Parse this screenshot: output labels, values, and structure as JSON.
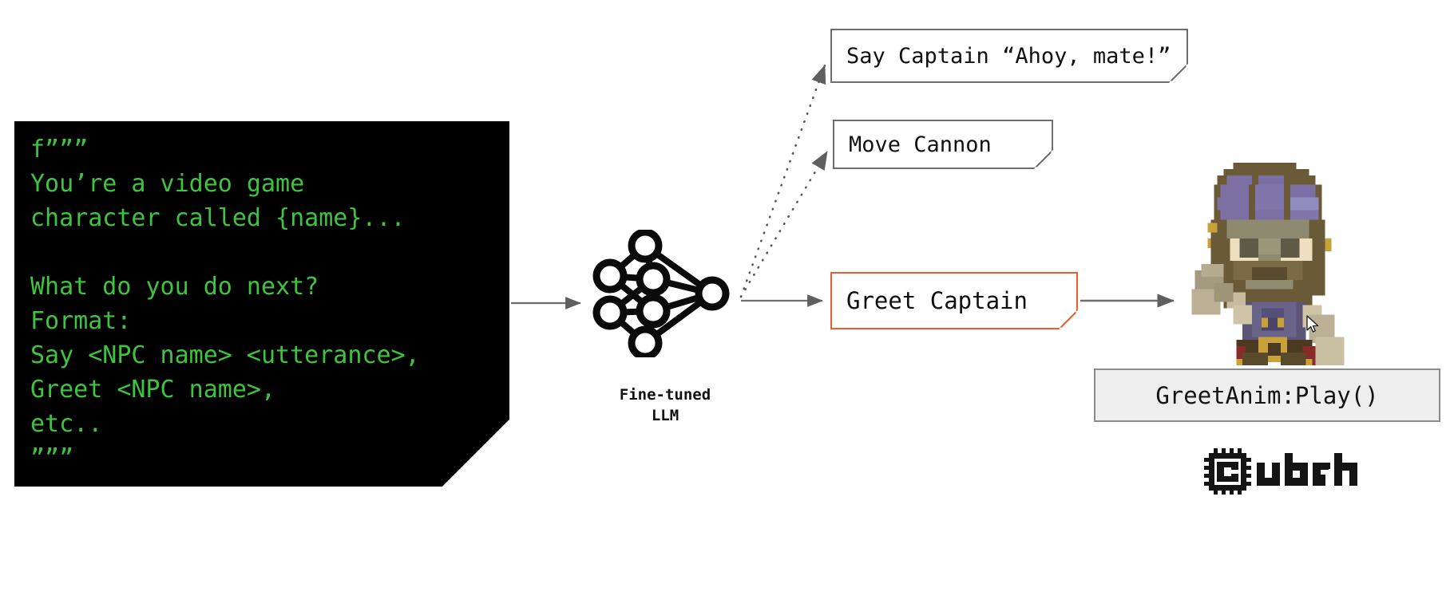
{
  "diagram": {
    "title": "Fine-tuned LLM game NPC action pipeline",
    "accent_color": "#ee5b2e",
    "code_text_color": "#3fc43f",
    "connector_color": "#6e6e6e"
  },
  "prompt_card": {
    "name": "prompt-template",
    "code": "f”””\nYou’re a video game\ncharacter called {name}...\n\nWhat do you do next?\nFormat:\nSay <NPC name> <utterance>,\nGreet <NPC name>,\netc..\n”””"
  },
  "model": {
    "icon": "neural-network-icon",
    "label_line1": "Fine-tuned",
    "label_line2": "LLM",
    "label": "Fine-tuned\nLLM"
  },
  "candidate_outputs": [
    {
      "id": "say",
      "label": "Say Captain “Ahoy, mate!”",
      "selected": false
    },
    {
      "id": "move",
      "label": "Move Cannon",
      "selected": false
    }
  ],
  "chosen_output": {
    "id": "greet",
    "label": "Greet Captain",
    "selected": true,
    "border_color": "#ee5b2e"
  },
  "game_action": {
    "label": "GreetAnim:Play()"
  },
  "character": {
    "name": "pirate-npc-sprite",
    "description": "voxel pirate character waving"
  },
  "brand": {
    "name": "cubzh",
    "icon": "cubzh-chip-logo"
  }
}
